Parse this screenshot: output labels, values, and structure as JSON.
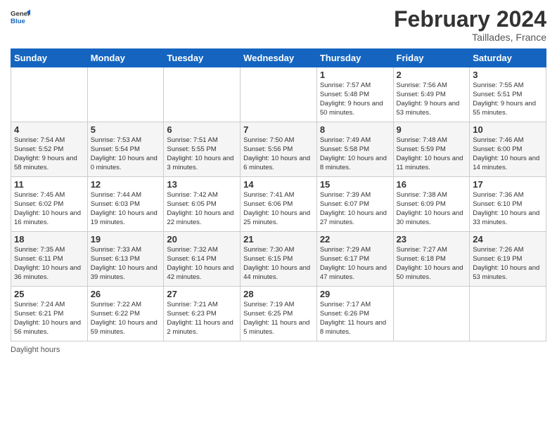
{
  "header": {
    "logo_general": "General",
    "logo_blue": "Blue",
    "month_title": "February 2024",
    "location": "Taillades, France"
  },
  "days_of_week": [
    "Sunday",
    "Monday",
    "Tuesday",
    "Wednesday",
    "Thursday",
    "Friday",
    "Saturday"
  ],
  "weeks": [
    [
      {
        "day": "",
        "info": ""
      },
      {
        "day": "",
        "info": ""
      },
      {
        "day": "",
        "info": ""
      },
      {
        "day": "",
        "info": ""
      },
      {
        "day": "1",
        "info": "Sunrise: 7:57 AM\nSunset: 5:48 PM\nDaylight: 9 hours and 50 minutes."
      },
      {
        "day": "2",
        "info": "Sunrise: 7:56 AM\nSunset: 5:49 PM\nDaylight: 9 hours and 53 minutes."
      },
      {
        "day": "3",
        "info": "Sunrise: 7:55 AM\nSunset: 5:51 PM\nDaylight: 9 hours and 55 minutes."
      }
    ],
    [
      {
        "day": "4",
        "info": "Sunrise: 7:54 AM\nSunset: 5:52 PM\nDaylight: 9 hours and 58 minutes."
      },
      {
        "day": "5",
        "info": "Sunrise: 7:53 AM\nSunset: 5:54 PM\nDaylight: 10 hours and 0 minutes."
      },
      {
        "day": "6",
        "info": "Sunrise: 7:51 AM\nSunset: 5:55 PM\nDaylight: 10 hours and 3 minutes."
      },
      {
        "day": "7",
        "info": "Sunrise: 7:50 AM\nSunset: 5:56 PM\nDaylight: 10 hours and 6 minutes."
      },
      {
        "day": "8",
        "info": "Sunrise: 7:49 AM\nSunset: 5:58 PM\nDaylight: 10 hours and 8 minutes."
      },
      {
        "day": "9",
        "info": "Sunrise: 7:48 AM\nSunset: 5:59 PM\nDaylight: 10 hours and 11 minutes."
      },
      {
        "day": "10",
        "info": "Sunrise: 7:46 AM\nSunset: 6:00 PM\nDaylight: 10 hours and 14 minutes."
      }
    ],
    [
      {
        "day": "11",
        "info": "Sunrise: 7:45 AM\nSunset: 6:02 PM\nDaylight: 10 hours and 16 minutes."
      },
      {
        "day": "12",
        "info": "Sunrise: 7:44 AM\nSunset: 6:03 PM\nDaylight: 10 hours and 19 minutes."
      },
      {
        "day": "13",
        "info": "Sunrise: 7:42 AM\nSunset: 6:05 PM\nDaylight: 10 hours and 22 minutes."
      },
      {
        "day": "14",
        "info": "Sunrise: 7:41 AM\nSunset: 6:06 PM\nDaylight: 10 hours and 25 minutes."
      },
      {
        "day": "15",
        "info": "Sunrise: 7:39 AM\nSunset: 6:07 PM\nDaylight: 10 hours and 27 minutes."
      },
      {
        "day": "16",
        "info": "Sunrise: 7:38 AM\nSunset: 6:09 PM\nDaylight: 10 hours and 30 minutes."
      },
      {
        "day": "17",
        "info": "Sunrise: 7:36 AM\nSunset: 6:10 PM\nDaylight: 10 hours and 33 minutes."
      }
    ],
    [
      {
        "day": "18",
        "info": "Sunrise: 7:35 AM\nSunset: 6:11 PM\nDaylight: 10 hours and 36 minutes."
      },
      {
        "day": "19",
        "info": "Sunrise: 7:33 AM\nSunset: 6:13 PM\nDaylight: 10 hours and 39 minutes."
      },
      {
        "day": "20",
        "info": "Sunrise: 7:32 AM\nSunset: 6:14 PM\nDaylight: 10 hours and 42 minutes."
      },
      {
        "day": "21",
        "info": "Sunrise: 7:30 AM\nSunset: 6:15 PM\nDaylight: 10 hours and 44 minutes."
      },
      {
        "day": "22",
        "info": "Sunrise: 7:29 AM\nSunset: 6:17 PM\nDaylight: 10 hours and 47 minutes."
      },
      {
        "day": "23",
        "info": "Sunrise: 7:27 AM\nSunset: 6:18 PM\nDaylight: 10 hours and 50 minutes."
      },
      {
        "day": "24",
        "info": "Sunrise: 7:26 AM\nSunset: 6:19 PM\nDaylight: 10 hours and 53 minutes."
      }
    ],
    [
      {
        "day": "25",
        "info": "Sunrise: 7:24 AM\nSunset: 6:21 PM\nDaylight: 10 hours and 56 minutes."
      },
      {
        "day": "26",
        "info": "Sunrise: 7:22 AM\nSunset: 6:22 PM\nDaylight: 10 hours and 59 minutes."
      },
      {
        "day": "27",
        "info": "Sunrise: 7:21 AM\nSunset: 6:23 PM\nDaylight: 11 hours and 2 minutes."
      },
      {
        "day": "28",
        "info": "Sunrise: 7:19 AM\nSunset: 6:25 PM\nDaylight: 11 hours and 5 minutes."
      },
      {
        "day": "29",
        "info": "Sunrise: 7:17 AM\nSunset: 6:26 PM\nDaylight: 11 hours and 8 minutes."
      },
      {
        "day": "",
        "info": ""
      },
      {
        "day": "",
        "info": ""
      }
    ]
  ],
  "footer": {
    "daylight_label": "Daylight hours"
  }
}
